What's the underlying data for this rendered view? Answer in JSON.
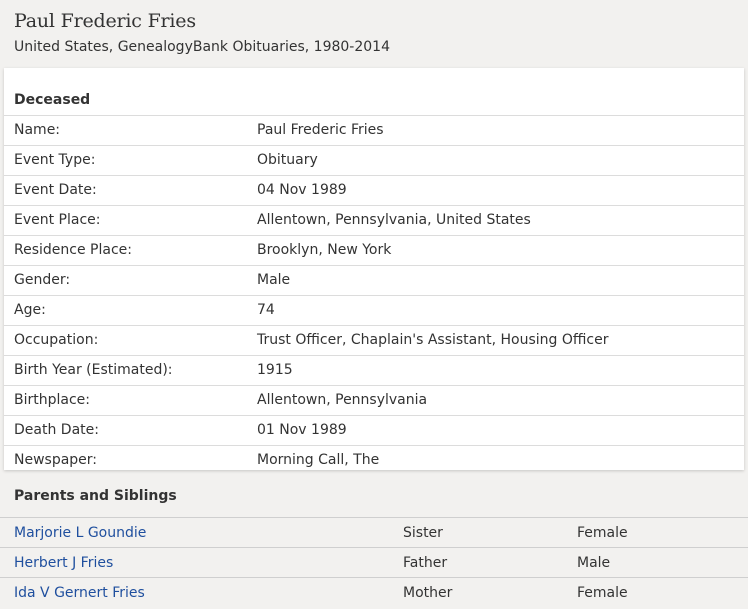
{
  "header": {
    "name": "Paul Frederic Fries",
    "collection": "United States, GenealogyBank Obituaries, 1980-2014"
  },
  "deceased": {
    "section_title": "Deceased",
    "fields": [
      {
        "label": "Name:",
        "value": "Paul Frederic Fries",
        "link": true
      },
      {
        "label": "Event Type:",
        "value": "Obituary",
        "link": false
      },
      {
        "label": "Event Date:",
        "value": "04 Nov 1989",
        "link": false
      },
      {
        "label": "Event Place:",
        "value": "Allentown, Pennsylvania, United States",
        "link": false
      },
      {
        "label": "Residence Place:",
        "value": "Brooklyn, New York",
        "link": false
      },
      {
        "label": "Gender:",
        "value": "Male",
        "link": false
      },
      {
        "label": "Age:",
        "value": "74",
        "link": false
      },
      {
        "label": "Occupation:",
        "value": "Trust Officer, Chaplain's Assistant, Housing Officer",
        "link": false
      },
      {
        "label": "Birth Year (Estimated):",
        "value": "1915",
        "link": false
      },
      {
        "label": "Birthplace:",
        "value": "Allentown, Pennsylvania",
        "link": false
      },
      {
        "label": "Death Date:",
        "value": "01 Nov 1989",
        "link": false
      },
      {
        "label": "Newspaper:",
        "value": "Morning Call, The",
        "link": false
      }
    ]
  },
  "parents_siblings": {
    "section_title": "Parents and Siblings",
    "people": [
      {
        "name": "Marjorie L Goundie",
        "relationship": "Sister",
        "gender": "Female"
      },
      {
        "name": "Herbert J Fries",
        "relationship": "Father",
        "gender": "Male"
      },
      {
        "name": "Ida V Gernert Fries",
        "relationship": "Mother",
        "gender": "Female"
      }
    ]
  },
  "colors": {
    "link": "#1f4f9e",
    "background": "#f2f1ef",
    "card": "#ffffff"
  }
}
